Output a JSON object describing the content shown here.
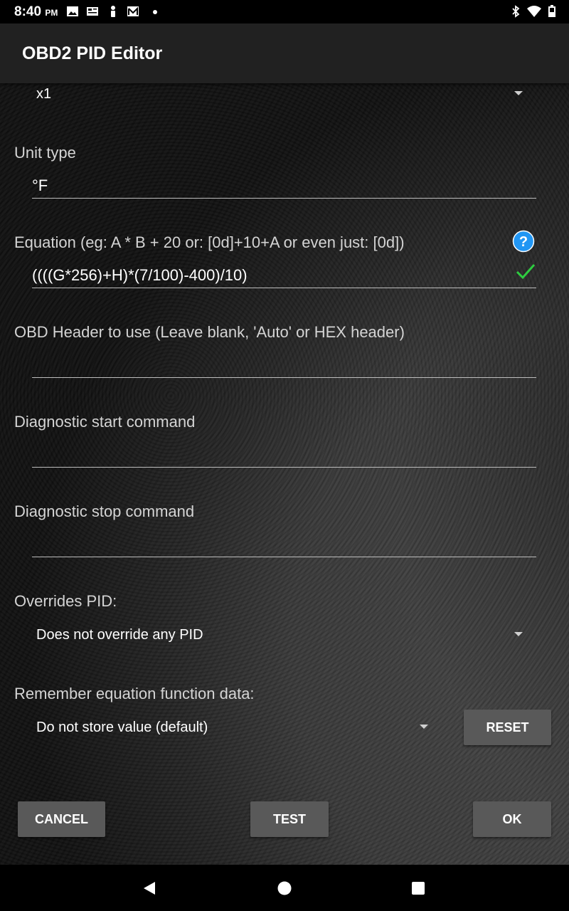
{
  "status_bar": {
    "time": "8:40",
    "ampm": "PM"
  },
  "app_bar": {
    "title": "OBD2 PID Editor"
  },
  "form": {
    "scale_value": "x1",
    "unit_type_label": "Unit type",
    "unit_type_value": "°F",
    "equation_label": "Equation (eg:  A * B + 20   or: [0d]+10+A  or even just: [0d])",
    "equation_value": "((((G*256)+H)*(7/100)-400)/10)",
    "header_label": "OBD Header to use (Leave blank, 'Auto' or HEX header)",
    "header_value": "",
    "diag_start_label": "Diagnostic start command",
    "diag_start_value": "",
    "diag_stop_label": "Diagnostic stop command",
    "diag_stop_value": "",
    "overrides_label": "Overrides PID:",
    "overrides_value": "Does not override any PID",
    "remember_label": "Remember equation function data:",
    "remember_value": "Do not store value (default)",
    "reset_label": "RESET"
  },
  "buttons": {
    "cancel": "CANCEL",
    "test": "TEST",
    "ok": "OK"
  },
  "icons": {
    "help": "help-circle-icon",
    "valid": "checkmark-icon",
    "back": "back-triangle-icon",
    "home": "home-circle-icon",
    "recents": "recents-square-icon"
  },
  "colors": {
    "help_blue": "#2196f3",
    "check_green": "#2ecc40",
    "button_gray": "#595959"
  }
}
